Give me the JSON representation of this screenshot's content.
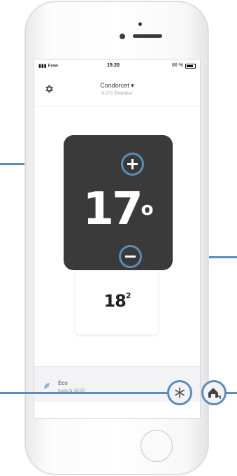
{
  "status_bar": {
    "carrier": "Free",
    "time": "15:20",
    "battery": "86 %"
  },
  "header": {
    "location": "Condorcet",
    "exterior": "6.2°C Extérieur"
  },
  "thermostat": {
    "target_temp": "17",
    "current_temp": "18",
    "current_temp_decimal": "2"
  },
  "mode": {
    "label": "Éco",
    "until": "jusqu'à 19:00"
  },
  "icons": {
    "settings": "gear-icon",
    "increase": "plus-icon",
    "decrease": "minus-icon",
    "frost_guard": "snowflake-icon",
    "away": "house-away-icon"
  },
  "colors": {
    "accent": "#5b8db8",
    "display": "#3a3a3a"
  }
}
